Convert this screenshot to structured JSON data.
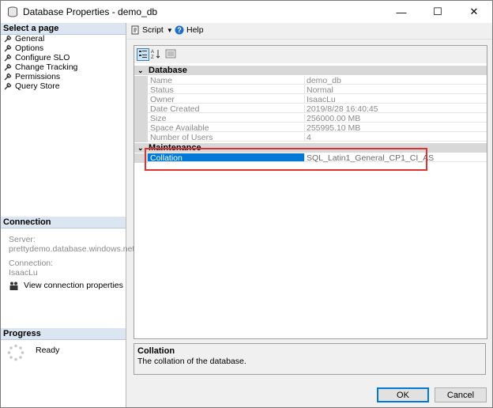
{
  "window": {
    "title": "Database Properties - demo_db",
    "minimize": "—",
    "maximize": "☐",
    "close": "✕"
  },
  "sidebar": {
    "select_page_header": "Select a page",
    "pages": [
      {
        "label": "General"
      },
      {
        "label": "Options"
      },
      {
        "label": "Configure SLO"
      },
      {
        "label": "Change Tracking"
      },
      {
        "label": "Permissions"
      },
      {
        "label": "Query Store"
      }
    ],
    "connection_header": "Connection",
    "server_label": "Server:",
    "server_value": "prettydemo.database.windows.net",
    "connection_label": "Connection:",
    "connection_value": "IsaacLu",
    "view_connection_link": "View connection properties",
    "progress_header": "Progress",
    "progress_status": "Ready"
  },
  "toolbar": {
    "script_label": "Script",
    "help_label": "Help"
  },
  "property_grid": {
    "categories": [
      {
        "name": "Database",
        "rows": [
          {
            "name": "Name",
            "value": "demo_db"
          },
          {
            "name": "Status",
            "value": "Normal"
          },
          {
            "name": "Owner",
            "value": "IsaacLu"
          },
          {
            "name": "Date Created",
            "value": "2019/8/28 16:40:45"
          },
          {
            "name": "Size",
            "value": "256000.00 MB"
          },
          {
            "name": "Space Available",
            "value": "255995.10 MB"
          },
          {
            "name": "Number of Users",
            "value": "4"
          }
        ]
      },
      {
        "name": "Maintenance",
        "rows": [
          {
            "name": "Collation",
            "value": "SQL_Latin1_General_CP1_CI_AS",
            "selected": true
          }
        ]
      }
    ]
  },
  "description": {
    "title": "Collation",
    "text": "The collation of the database."
  },
  "buttons": {
    "ok": "OK",
    "cancel": "Cancel"
  },
  "colors": {
    "selection": "#0078d7",
    "highlight_box": "#e0312e",
    "section_header": "#dce6f2"
  }
}
